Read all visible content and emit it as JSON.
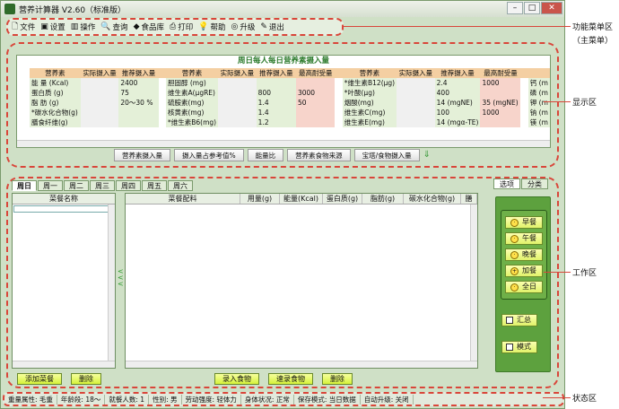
{
  "window": {
    "title": "营养计算器 V2.60（标准版）",
    "buttons": [
      "–",
      "□",
      "✕"
    ]
  },
  "menu": [
    {
      "label": "文件",
      "icon": "file-icon"
    },
    {
      "label": "设置",
      "icon": "settings-icon"
    },
    {
      "label": "操作",
      "icon": "chart-icon"
    },
    {
      "label": "查询",
      "icon": "search-icon"
    },
    {
      "label": "食品库",
      "icon": "library-icon"
    },
    {
      "label": "打印",
      "icon": "printer-icon"
    },
    {
      "label": "帮助",
      "icon": "help-icon"
    },
    {
      "label": "升级",
      "icon": "upgrade-icon"
    },
    {
      "label": "退出",
      "icon": "exit-icon"
    }
  ],
  "display": {
    "title": "周日每人每日营养素摄入量",
    "headers": {
      "nutrient": "营养素",
      "actual": "实际摄入量",
      "recommended": "推荐摄入量",
      "max": "最高耐受量"
    },
    "block1": [
      {
        "name": "能 量 (Kcal)",
        "rec": "2400",
        "max": ""
      },
      {
        "name": "蛋白质 (g)",
        "rec": "75",
        "max": ""
      },
      {
        "name": "脂 肪 (g)",
        "rec": "20～30 %",
        "max": ""
      },
      {
        "name": "*碳水化合物(g)",
        "rec": "",
        "max": ""
      },
      {
        "name": "膳食纤维(g)",
        "rec": "",
        "max": ""
      }
    ],
    "block2": [
      {
        "name": "胆固醇 (mg)",
        "rec": "",
        "max": ""
      },
      {
        "name": "维生素A(μgRE)",
        "rec": "800",
        "max": "3000"
      },
      {
        "name": "硫胺素(mg)",
        "rec": "1.4",
        "max": "50"
      },
      {
        "name": "核黄素(mg)",
        "rec": "1.4",
        "max": ""
      },
      {
        "name": "*维生素B6(mg)",
        "rec": "1.2",
        "max": ""
      }
    ],
    "block3": [
      {
        "name": "*维生素B12(μg)",
        "rec": "2.4",
        "max": "1000"
      },
      {
        "name": "*叶酸(μg)",
        "rec": "400",
        "max": ""
      },
      {
        "name": "烟酸(mg)",
        "rec": "14 (mgNE)",
        "max": "35 (mgNE)"
      },
      {
        "name": "维生素C(mg)",
        "rec": "100",
        "max": "1000"
      },
      {
        "name": "维生素E(mg)",
        "rec": "14 (mgα-TE)",
        "max": ""
      }
    ],
    "block4": [
      "钙 (m",
      "磷 (m",
      "钾 (m",
      "钠 (m",
      "镁 (m"
    ],
    "buttons": [
      "营养素摄入量",
      "摄入量占参考值%",
      "能量比",
      "营养素食物来源",
      "宝塔/食物摄入量"
    ]
  },
  "work": {
    "tabs": [
      "周日",
      "周一",
      "周二",
      "周三",
      "周四",
      "周五",
      "周六"
    ],
    "left_header": "菜餐名称",
    "grid_headers": [
      "菜餐配料",
      "用量(g)",
      "能量(Kcal)",
      "蛋白质(g)",
      "脂肪(g)",
      "碳水化合物(g)",
      "膳"
    ],
    "left_buttons": [
      "添加菜餐",
      "删除"
    ],
    "main_buttons": [
      "录入食物",
      "速录食物",
      "删除"
    ],
    "side_tabs": [
      "选项",
      "分类"
    ],
    "meals": [
      "早餐",
      "午餐",
      "晚餐",
      "加餐",
      "全日"
    ],
    "side_buttons": [
      "汇总",
      "模式"
    ]
  },
  "status": [
    "重量属性: 毛重",
    "年龄段: 18～",
    "就餐人数: 1",
    "性别: 男",
    "劳动强度: 轻体力",
    "身体状况: 正常",
    "保存模式: 当日数据",
    "自动升级: 关闭"
  ],
  "annotations": [
    "功能菜单区",
    "（主菜单）",
    "显示区",
    "工作区",
    "状态区"
  ]
}
